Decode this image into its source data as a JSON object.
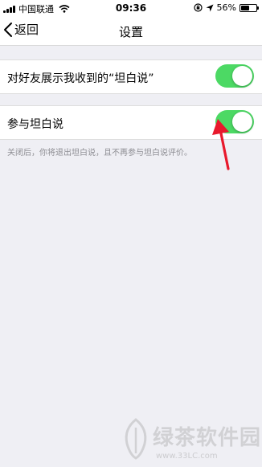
{
  "status_bar": {
    "carrier": "中国联通",
    "time": "09:36",
    "battery_percent": "56%",
    "battery_level": 0.56,
    "icons": [
      "signal-icon",
      "wifi-icon",
      "orientation-lock-icon",
      "location-icon",
      "battery-icon"
    ]
  },
  "nav": {
    "back_label": "返回",
    "title": "设置"
  },
  "settings": {
    "show_friends": {
      "label": "对好友展示我收到的“坦白说”",
      "enabled": true
    },
    "participate": {
      "label": "参与坦白说",
      "enabled": true,
      "footer": "关闭后，你将退出坦白说，且不再参与坦白说评价。"
    }
  },
  "annotation": {
    "color": "#e8192c",
    "icon": "red-arrow-icon"
  },
  "watermark": {
    "text": "绿茶软件园",
    "url": "www.33LC.com"
  },
  "colors": {
    "toggle_on": "#4cd964",
    "background": "#efeff4"
  }
}
